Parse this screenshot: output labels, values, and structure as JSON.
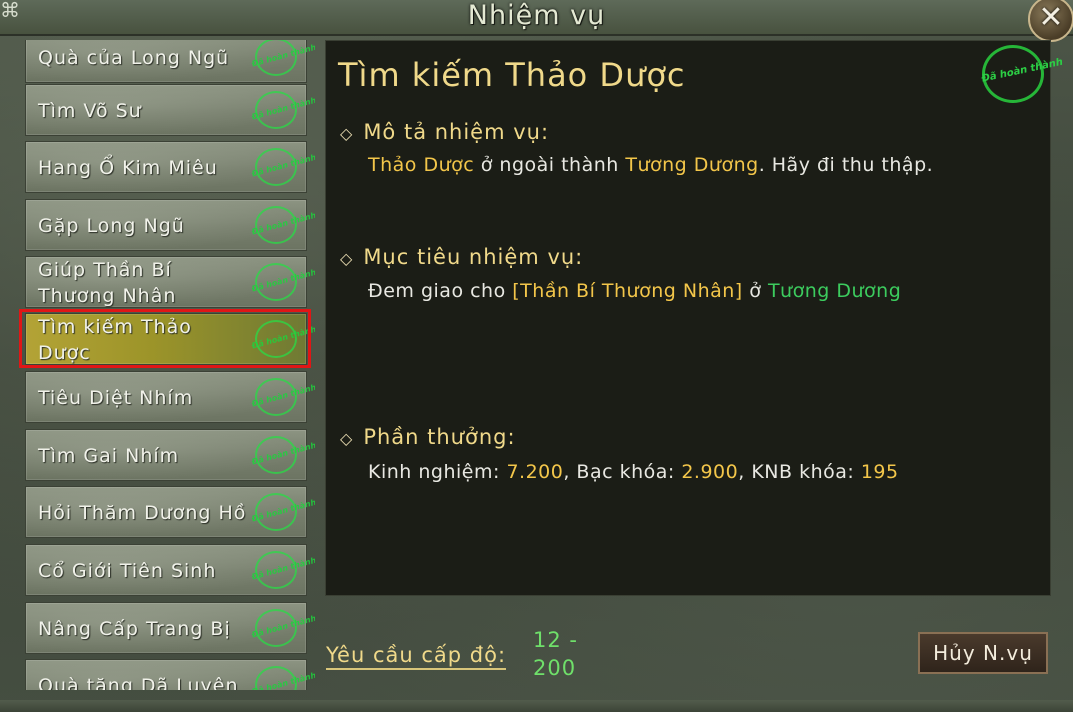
{
  "window": {
    "title": "Nhiệm vụ",
    "close_glyph": "✕",
    "corner_glyph": "⌘"
  },
  "quests": [
    {
      "label": "Quà của Long Ngũ",
      "stamp": "Đã hoàn thành"
    },
    {
      "label": "Tìm Võ Sư",
      "stamp": "Đã hoàn thành"
    },
    {
      "label": "Hang Ổ Kim Miêu",
      "stamp": "Đã hoàn thành"
    },
    {
      "label": "Gặp Long Ngũ",
      "stamp": "Đã hoàn thành"
    },
    {
      "label": "Giúp Thần Bí Thương Nhân",
      "stamp": "Đã hoàn thành"
    },
    {
      "label": "Tìm kiếm Thảo Dược",
      "stamp": "Đã hoàn thành",
      "selected": true
    },
    {
      "label": "Tiêu Diệt Nhím",
      "stamp": "Đã hoàn thành"
    },
    {
      "label": "Tìm Gai Nhím",
      "stamp": "Đã hoàn thành"
    },
    {
      "label": "Hỏi Thăm Dương Hồ",
      "stamp": "Đã hoàn thành"
    },
    {
      "label": "Cổ Giới Tiên Sinh",
      "stamp": "Đã hoàn thành"
    },
    {
      "label": "Nâng Cấp Trang Bị",
      "stamp": "Đã hoàn thành"
    },
    {
      "label": "Quà tặng Dã Luyện",
      "stamp": "Đã hoàn thành"
    }
  ],
  "detail": {
    "title": "Tìm kiếm Thảo Dược",
    "completed_stamp": "Đã hoàn thành",
    "diamond": "◇",
    "description": {
      "heading": "Mô tả nhiệm vụ:",
      "part1": "Thảo Dược",
      "part2": " ở ngoài thành ",
      "part3": "Tương Dương",
      "part4": ". Hãy đi thu thập."
    },
    "objective": {
      "heading": "Mục tiêu nhiệm vụ:",
      "part1": "Đem giao cho ",
      "part2": "[Thần Bí Thương Nhân]",
      "part3": " ở ",
      "part4": "Tương Dương"
    },
    "reward": {
      "heading": "Phần thưởng:",
      "exp_label": "Kinh nghiệm: ",
      "exp_value": "7.200",
      "silver_label": ", Bạc khóa: ",
      "silver_value": "2.900",
      "knb_label": ", KNB khóa: ",
      "knb_value": "195"
    }
  },
  "footer": {
    "level_label": "Yêu cầu cấp độ:",
    "level_value": "12 - 200",
    "cancel_label": "Hủy N.vụ"
  },
  "colors": {
    "accent_gold": "#f0d98a",
    "highlight_yellow": "#f3c64a",
    "highlight_green": "#3ccc5e",
    "selection_outline": "#e01616"
  }
}
